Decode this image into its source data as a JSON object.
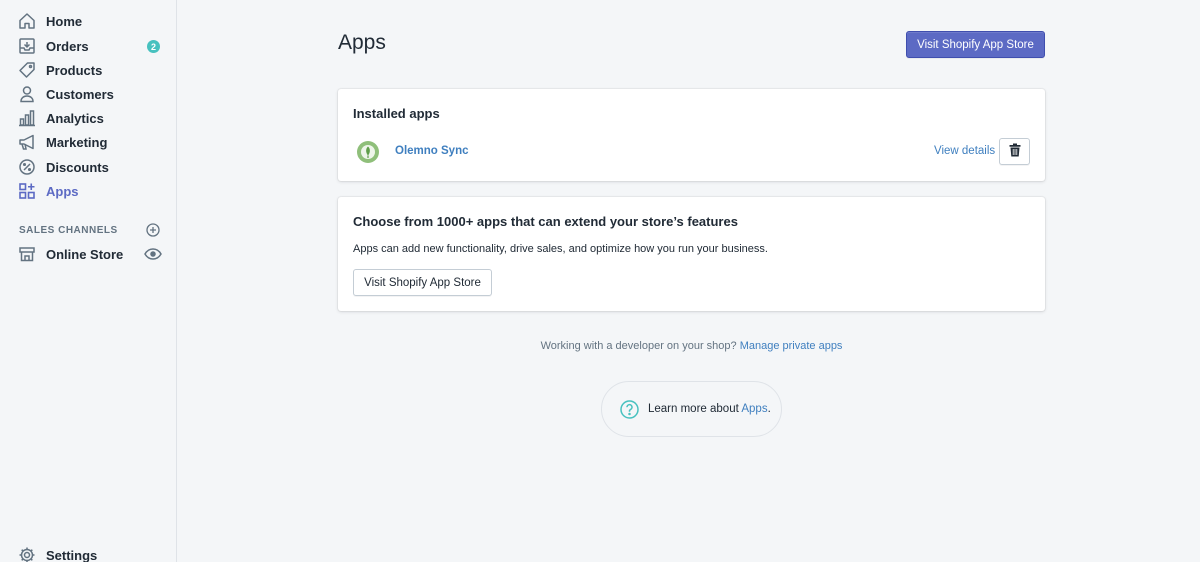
{
  "sidebar": {
    "items": [
      {
        "label": "Home",
        "icon": "home-icon"
      },
      {
        "label": "Orders",
        "icon": "orders-icon",
        "badge": "2"
      },
      {
        "label": "Products",
        "icon": "tag-icon"
      },
      {
        "label": "Customers",
        "icon": "person-icon"
      },
      {
        "label": "Analytics",
        "icon": "bar-chart-icon"
      },
      {
        "label": "Marketing",
        "icon": "megaphone-icon"
      },
      {
        "label": "Discounts",
        "icon": "discount-icon"
      },
      {
        "label": "Apps",
        "icon": "apps-icon",
        "active": true
      }
    ],
    "sales_channels_heading": "SALES CHANNELS",
    "channels": [
      {
        "label": "Online Store",
        "icon": "store-icon"
      }
    ],
    "settings_label": "Settings"
  },
  "main": {
    "title": "Apps",
    "primary_button": "Visit Shopify App Store",
    "installed_card": {
      "title": "Installed apps",
      "apps": [
        {
          "name": "Olemno Sync",
          "view_details": "View details"
        }
      ]
    },
    "discover_card": {
      "title": "Choose from 1000+ apps that can extend your store’s features",
      "description": "Apps can add new functionality, drive sales, and optimize how you run your business.",
      "button": "Visit Shopify App Store"
    },
    "footer": {
      "text": "Working with a developer on your shop?",
      "link": "Manage private apps"
    },
    "learn_more": {
      "prefix": "Learn more about",
      "link": "Apps",
      "suffix": "."
    }
  },
  "colors": {
    "accent": "#5c6ac4",
    "link": "#3f7fbf",
    "badge": "#47c1bf",
    "help_icon": "#47c1bf"
  }
}
